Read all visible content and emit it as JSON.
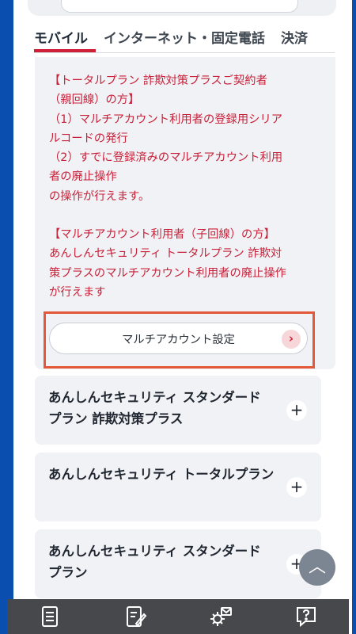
{
  "tabs": [
    {
      "label": "モバイル"
    },
    {
      "label": "インターネット・固定電話"
    },
    {
      "label": "決済"
    }
  ],
  "panel": {
    "lines": [
      "【トータルプラン 詐欺対策プラスご契約者",
      "（親回線）の方】",
      "（1）マルチアカウント利用者の登録用シリア",
      "ルコードの発行",
      "（2）すでに登録済みのマルチアカウント利用",
      "者の廃止操作",
      "の操作が行えます。",
      "【マルチアカウント利用者（子回線）の方】",
      "あんしんセキュリティ トータルプラン 詐欺対",
      "策プラスのマルチアカウント利用者の廃止操作",
      "が行えます"
    ],
    "button_label": "マルチアカウント設定",
    "button_arrow": "›"
  },
  "accordions": [
    {
      "title": "あんしんセキュリティ スタンダード プラン 詐欺対策プラス",
      "icon": "plus"
    },
    {
      "title": "あんしんセキュリティ トータルプラン",
      "icon": "plus"
    },
    {
      "title": "あんしんセキュリティ スタンダード プラン",
      "icon": "plus"
    }
  ],
  "scroll_top_glyph": "︿",
  "bottom_nav": [
    {
      "icon": "document-list-icon"
    },
    {
      "icon": "edit-document-icon"
    },
    {
      "icon": "settings-mail-icon"
    },
    {
      "icon": "help-chat-icon"
    }
  ],
  "colors": {
    "accent": "#cf1f36",
    "frame": "#0a4fb0",
    "highlight": "#e4583a"
  }
}
